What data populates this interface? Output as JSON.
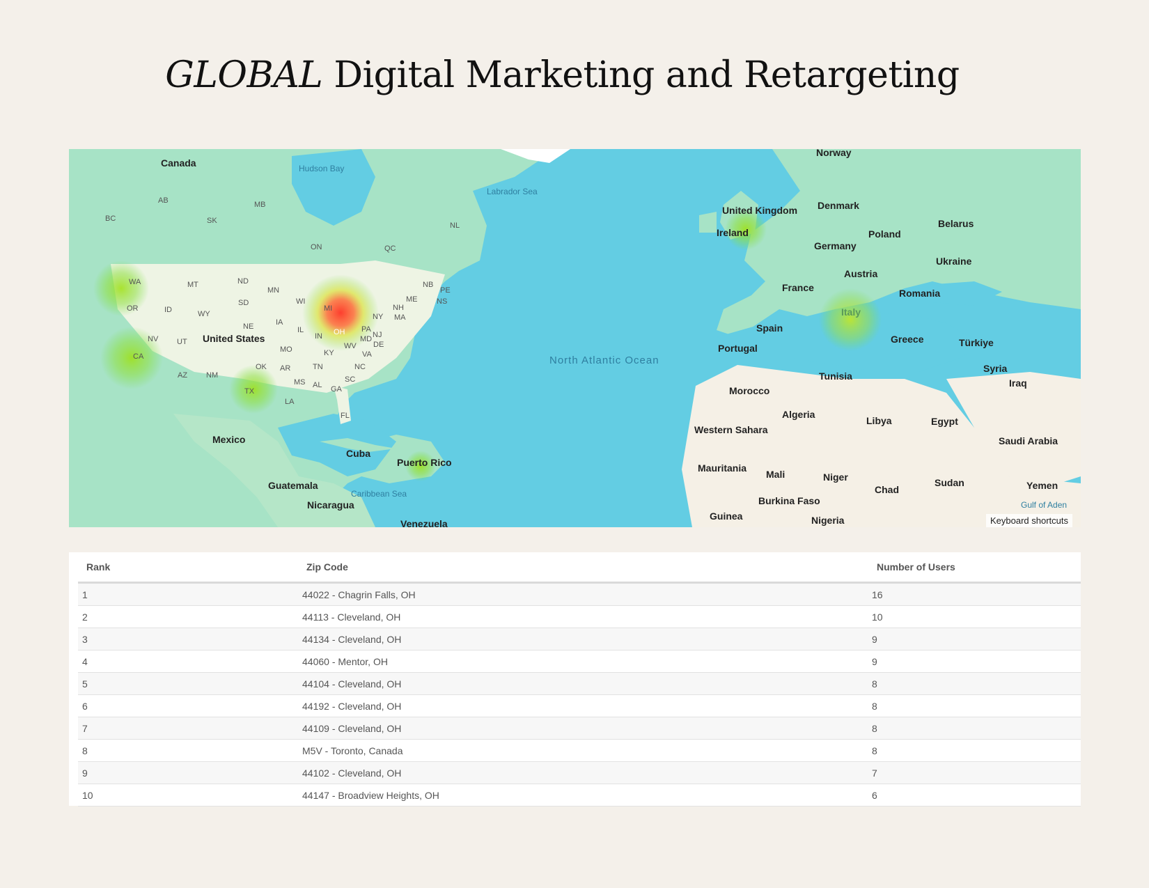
{
  "title": {
    "emphasis": "GLOBAL",
    "rest": "Digital Marketing and Retargeting"
  },
  "map": {
    "keyboard_shortcuts": "Keyboard shortcuts",
    "country_labels": [
      "Canada",
      "United States",
      "Mexico",
      "Cuba",
      "Puerto Rico",
      "Guatemala",
      "Nicaragua",
      "Venezuela",
      "Norway",
      "United Kingdom",
      "Denmark",
      "Ireland",
      "Germany",
      "Poland",
      "Belarus",
      "Ukraine",
      "Austria",
      "France",
      "Romania",
      "Italy",
      "Spain",
      "Portugal",
      "Greece",
      "Türkiye",
      "Syria",
      "Iraq",
      "Tunisia",
      "Morocco",
      "Algeria",
      "Libya",
      "Egypt",
      "Western Sahara",
      "Saudi Arabia",
      "Mauritania",
      "Mali",
      "Niger",
      "Chad",
      "Sudan",
      "Yemen",
      "Burkina Faso",
      "Guinea",
      "Nigeria"
    ],
    "water_labels": [
      "Hudson Bay",
      "Labrador Sea",
      "North Atlantic Ocean",
      "Caribbean Sea",
      "Gulf of Aden"
    ],
    "region_labels": [
      "AB",
      "BC",
      "SK",
      "MB",
      "ON",
      "QC",
      "NL",
      "NB",
      "PE",
      "NS",
      "WA",
      "MT",
      "ND",
      "MN",
      "WI",
      "MI",
      "NY",
      "ME",
      "NH",
      "MA",
      "OR",
      "ID",
      "WY",
      "SD",
      "IA",
      "IL",
      "IN",
      "OH",
      "PA",
      "NJ",
      "NE",
      "NV",
      "UT",
      "CA",
      "AZ",
      "NM",
      "OK",
      "TX",
      "MO",
      "KY",
      "WV",
      "MD",
      "DE",
      "VA",
      "AR",
      "TN",
      "NC",
      "MS",
      "AL",
      "GA",
      "SC",
      "LA",
      "FL"
    ],
    "heat_hotspots": [
      {
        "place": "Ohio",
        "intensity": "high"
      },
      {
        "place": "Washington",
        "intensity": "low"
      },
      {
        "place": "California",
        "intensity": "low"
      },
      {
        "place": "Texas",
        "intensity": "low"
      },
      {
        "place": "Puerto Rico",
        "intensity": "low"
      },
      {
        "place": "United Kingdom",
        "intensity": "low"
      },
      {
        "place": "Italy",
        "intensity": "medium"
      }
    ]
  },
  "table": {
    "headers": [
      "Rank",
      "Zip Code",
      "Number of Users"
    ],
    "rows": [
      [
        "1",
        "44022 - Chagrin Falls, OH",
        "16"
      ],
      [
        "2",
        "44113 - Cleveland, OH",
        "10"
      ],
      [
        "3",
        "44134 - Cleveland, OH",
        "9"
      ],
      [
        "4",
        "44060 - Mentor, OH",
        "9"
      ],
      [
        "5",
        "44104 - Cleveland, OH",
        "8"
      ],
      [
        "6",
        "44192 - Cleveland, OH",
        "8"
      ],
      [
        "7",
        "44109 - Cleveland, OH",
        "8"
      ],
      [
        "8",
        "M5V - Toronto, Canada",
        "8"
      ],
      [
        "9",
        "44102 - Cleveland, OH",
        "7"
      ],
      [
        "10",
        "44147 - Broadview Heights, OH",
        "6"
      ]
    ]
  }
}
